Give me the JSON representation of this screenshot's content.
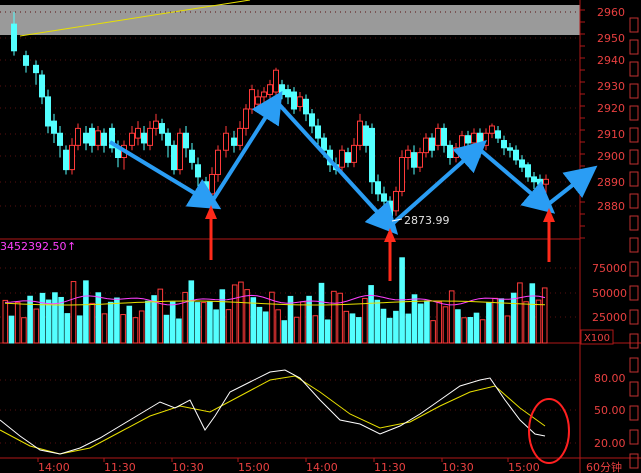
{
  "main_panel": {
    "price_axis": [
      "2960",
      "2950",
      "2940",
      "2930",
      "2920",
      "2910",
      "2900",
      "2890",
      "2880"
    ],
    "low_annotation": "2873.99"
  },
  "volume_panel": {
    "readout": "3452392.50",
    "axis": [
      "75000",
      "50000",
      "25000"
    ],
    "unit": "X100"
  },
  "osc_panel": {
    "axis": [
      "80.00",
      "50.00",
      "20.00"
    ]
  },
  "time_axis": {
    "labels": [
      "14:00",
      "11:30",
      "10:30",
      "15:00",
      "14:00",
      "11:30",
      "10:30",
      "15:00"
    ],
    "period_label": "60分钟"
  },
  "colors": {
    "up": "#ff3a3a",
    "down": "#54ffff",
    "arrow_blue": "#2a9df4",
    "arrow_red": "#ff2a1a",
    "ma_white": "#ffffff",
    "ma_yellow": "#e8e000",
    "ma_magenta": "#ff40ff",
    "axis_red": "#b01818",
    "label_red": "#e84040"
  }
}
